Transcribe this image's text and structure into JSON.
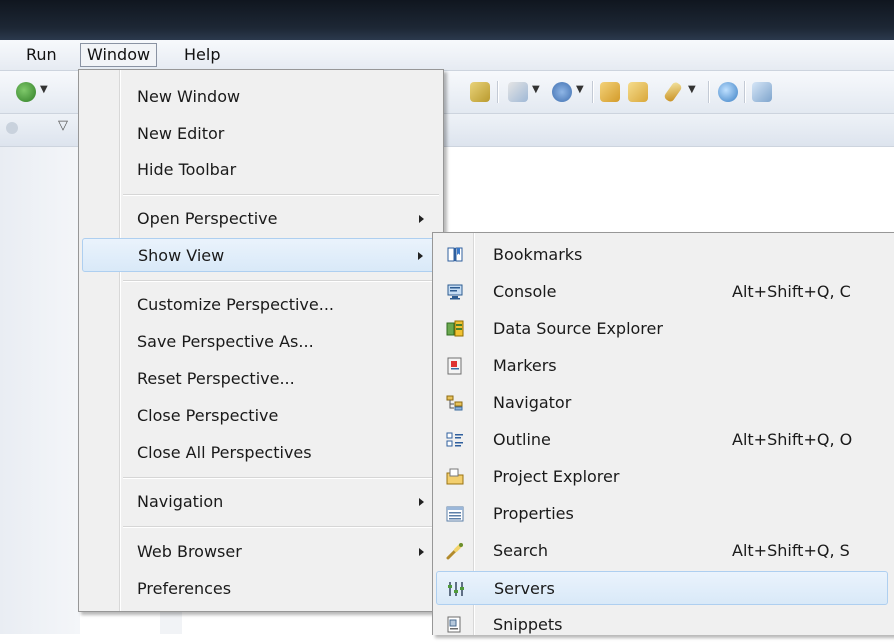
{
  "menubar": {
    "items": [
      {
        "label": "Run"
      },
      {
        "label": "Window"
      },
      {
        "label": "Help"
      }
    ]
  },
  "window_menu": {
    "items": [
      {
        "label": "New Window"
      },
      {
        "label": "New Editor"
      },
      {
        "label": "Hide Toolbar"
      },
      {
        "label": "Open Perspective",
        "submenu": true
      },
      {
        "label": "Show View",
        "submenu": true,
        "highlighted": true
      },
      {
        "label": "Customize Perspective..."
      },
      {
        "label": "Save Perspective As..."
      },
      {
        "label": "Reset Perspective..."
      },
      {
        "label": "Close Perspective"
      },
      {
        "label": "Close All Perspectives"
      },
      {
        "label": "Navigation",
        "submenu": true
      },
      {
        "label": "Web Browser",
        "submenu": true
      },
      {
        "label": "Preferences"
      }
    ]
  },
  "show_view_menu": {
    "items": [
      {
        "label": "Bookmarks",
        "icon": "bookmarks-icon",
        "shortcut": ""
      },
      {
        "label": "Console",
        "icon": "console-icon",
        "shortcut": "Alt+Shift+Q, C"
      },
      {
        "label": "Data Source Explorer",
        "icon": "data-source-explorer-icon",
        "shortcut": ""
      },
      {
        "label": "Markers",
        "icon": "markers-icon",
        "shortcut": ""
      },
      {
        "label": "Navigator",
        "icon": "navigator-icon",
        "shortcut": ""
      },
      {
        "label": "Outline",
        "icon": "outline-icon",
        "shortcut": "Alt+Shift+Q, O"
      },
      {
        "label": "Project Explorer",
        "icon": "project-explorer-icon",
        "shortcut": ""
      },
      {
        "label": "Properties",
        "icon": "properties-icon",
        "shortcut": ""
      },
      {
        "label": "Search",
        "icon": "search-icon",
        "shortcut": "Alt+Shift+Q, S"
      },
      {
        "label": "Servers",
        "icon": "servers-icon",
        "shortcut": "",
        "highlighted": true
      },
      {
        "label": "Snippets",
        "icon": "snippets-icon",
        "shortcut": ""
      }
    ]
  },
  "colors": {
    "menu_bg": "#f0f0f0",
    "highlight_bg": "#dbeaf9",
    "highlight_border": "#aecff0",
    "titlebar": "#141c27"
  }
}
